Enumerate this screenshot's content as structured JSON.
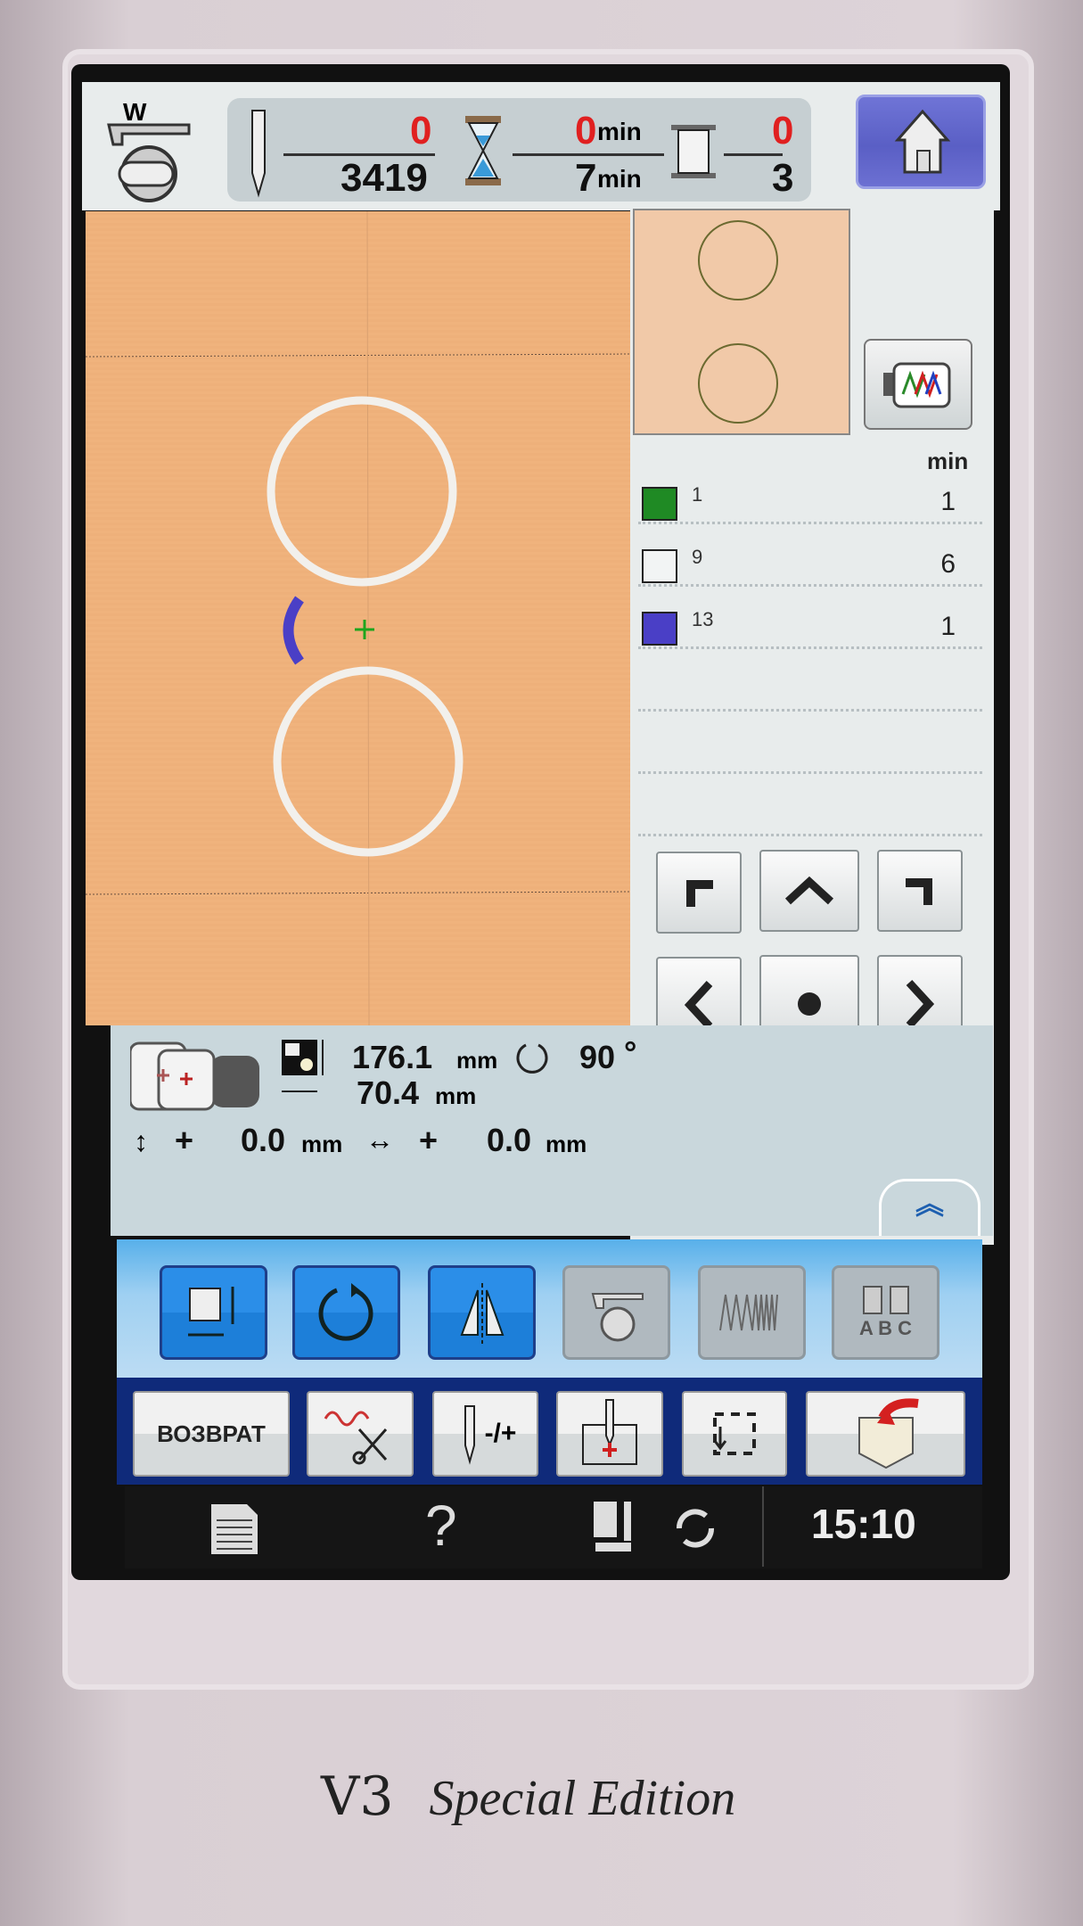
{
  "topbar": {
    "stitch_current": "0",
    "stitch_total": "3419",
    "time_current": "0",
    "time_total": "7",
    "time_unit": "min",
    "color_current": "0",
    "color_total": "3",
    "foot_label": "W"
  },
  "colors": {
    "header": "min",
    "items": [
      {
        "number": "1",
        "minutes": "1",
        "color": "#1f8a24"
      },
      {
        "number": "9",
        "minutes": "6",
        "color": "#f2f4f4"
      },
      {
        "number": "13",
        "minutes": "1",
        "color": "#4a3fc6"
      }
    ]
  },
  "info": {
    "height": "176.1",
    "width": "70.4",
    "unit": "mm",
    "rotation": "90",
    "degree": "°",
    "vertical_offset": "0.0",
    "horizontal_offset": "0.0",
    "plus": "+"
  },
  "bottom": {
    "back_label": "ВОЗВРАТ",
    "needle_label": "-/+",
    "abc_label": "A B C"
  },
  "status": {
    "help": "?",
    "time": "15:10"
  },
  "device": {
    "model": "V3",
    "edition": "Special Edition"
  }
}
